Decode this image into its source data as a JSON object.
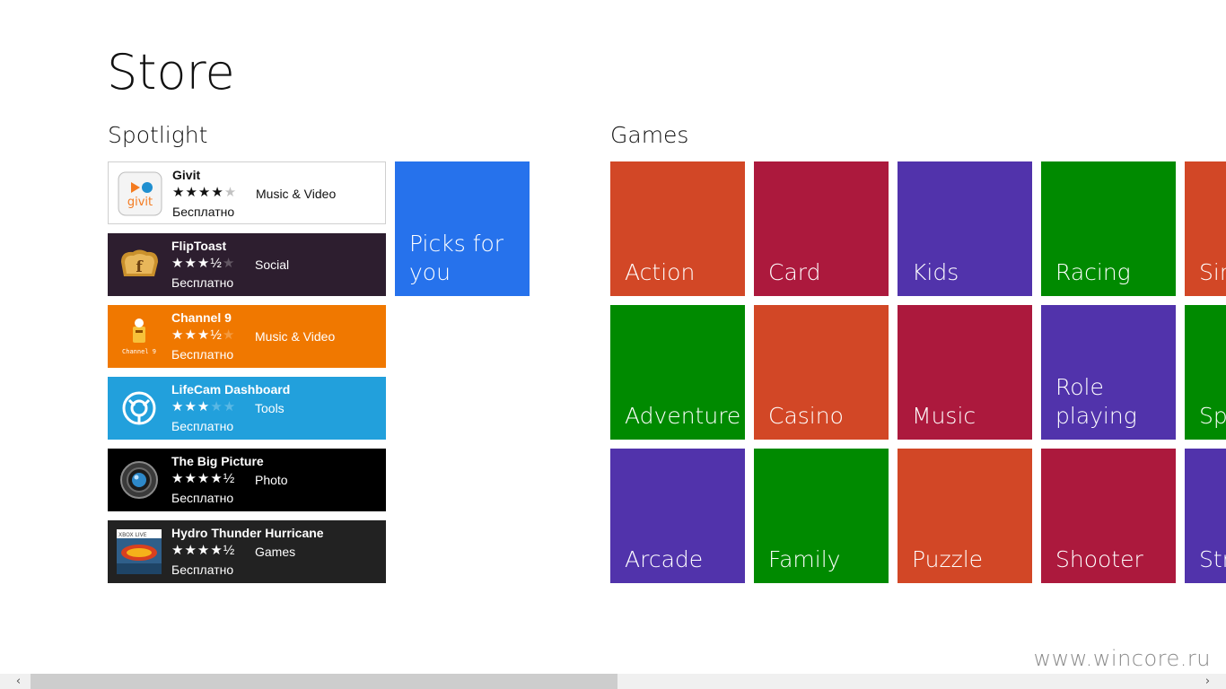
{
  "header": {
    "title": "Store"
  },
  "spotlight": {
    "title": "Spotlight",
    "picks_label": "Picks for you",
    "apps": [
      {
        "name": "Givit",
        "rating": 4,
        "rating_text": "★★★★★",
        "category": "Music & Video",
        "price": "Бесплатно",
        "icon": "givit-logo-icon",
        "bg": "#ffffff"
      },
      {
        "name": "FlipToast",
        "rating": 3.5,
        "rating_text": "★★★★★",
        "category": "Social",
        "price": "Бесплатно",
        "icon": "toast-icon",
        "bg": "#2d1e2f"
      },
      {
        "name": "Channel 9",
        "rating": 3.5,
        "rating_text": "★★★★★",
        "category": "Music & Video",
        "price": "Бесплатно",
        "icon": "channel9-icon",
        "bg": "#f07800"
      },
      {
        "name": "LifeCam Dashboard",
        "rating": 3,
        "rating_text": "★★★★★",
        "category": "Tools",
        "price": "Бесплатно",
        "icon": "lifecam-icon",
        "bg": "#22a0dc"
      },
      {
        "name": "The Big Picture",
        "rating": 4.5,
        "rating_text": "★★★★★",
        "category": "Photo",
        "price": "Бесплатно",
        "icon": "camera-lens-icon",
        "bg": "#000000"
      },
      {
        "name": "Hydro Thunder Hurricane",
        "rating": 4.5,
        "rating_text": "★★★★★",
        "category": "Games",
        "price": "Бесплатно",
        "icon": "hydro-thunder-icon",
        "icon_caption": "XBOX LIVE",
        "bg": "#222222"
      }
    ]
  },
  "games": {
    "title": "Games",
    "tiles": [
      {
        "label": "Action",
        "color": "#d24726"
      },
      {
        "label": "Card",
        "color": "#ac193d"
      },
      {
        "label": "Kids",
        "color": "#5133ab"
      },
      {
        "label": "Racing",
        "color": "#008a00"
      },
      {
        "label": "Sin",
        "color": "#d24726"
      },
      {
        "label": "Adventure",
        "color": "#008a00"
      },
      {
        "label": "Casino",
        "color": "#d24726"
      },
      {
        "label": "Music",
        "color": "#ac193d"
      },
      {
        "label": "Role\nplaying",
        "color": "#5133ab"
      },
      {
        "label": "Sp",
        "color": "#008a00"
      },
      {
        "label": "Arcade",
        "color": "#5133ab"
      },
      {
        "label": "Family",
        "color": "#008a00"
      },
      {
        "label": "Puzzle",
        "color": "#d24726"
      },
      {
        "label": "Shooter",
        "color": "#ac193d"
      },
      {
        "label": "Str",
        "color": "#5133ab"
      }
    ]
  },
  "watermark": "www.wincore.ru",
  "scrollbar": {
    "left_arrow": "‹",
    "right_arrow": "›"
  }
}
